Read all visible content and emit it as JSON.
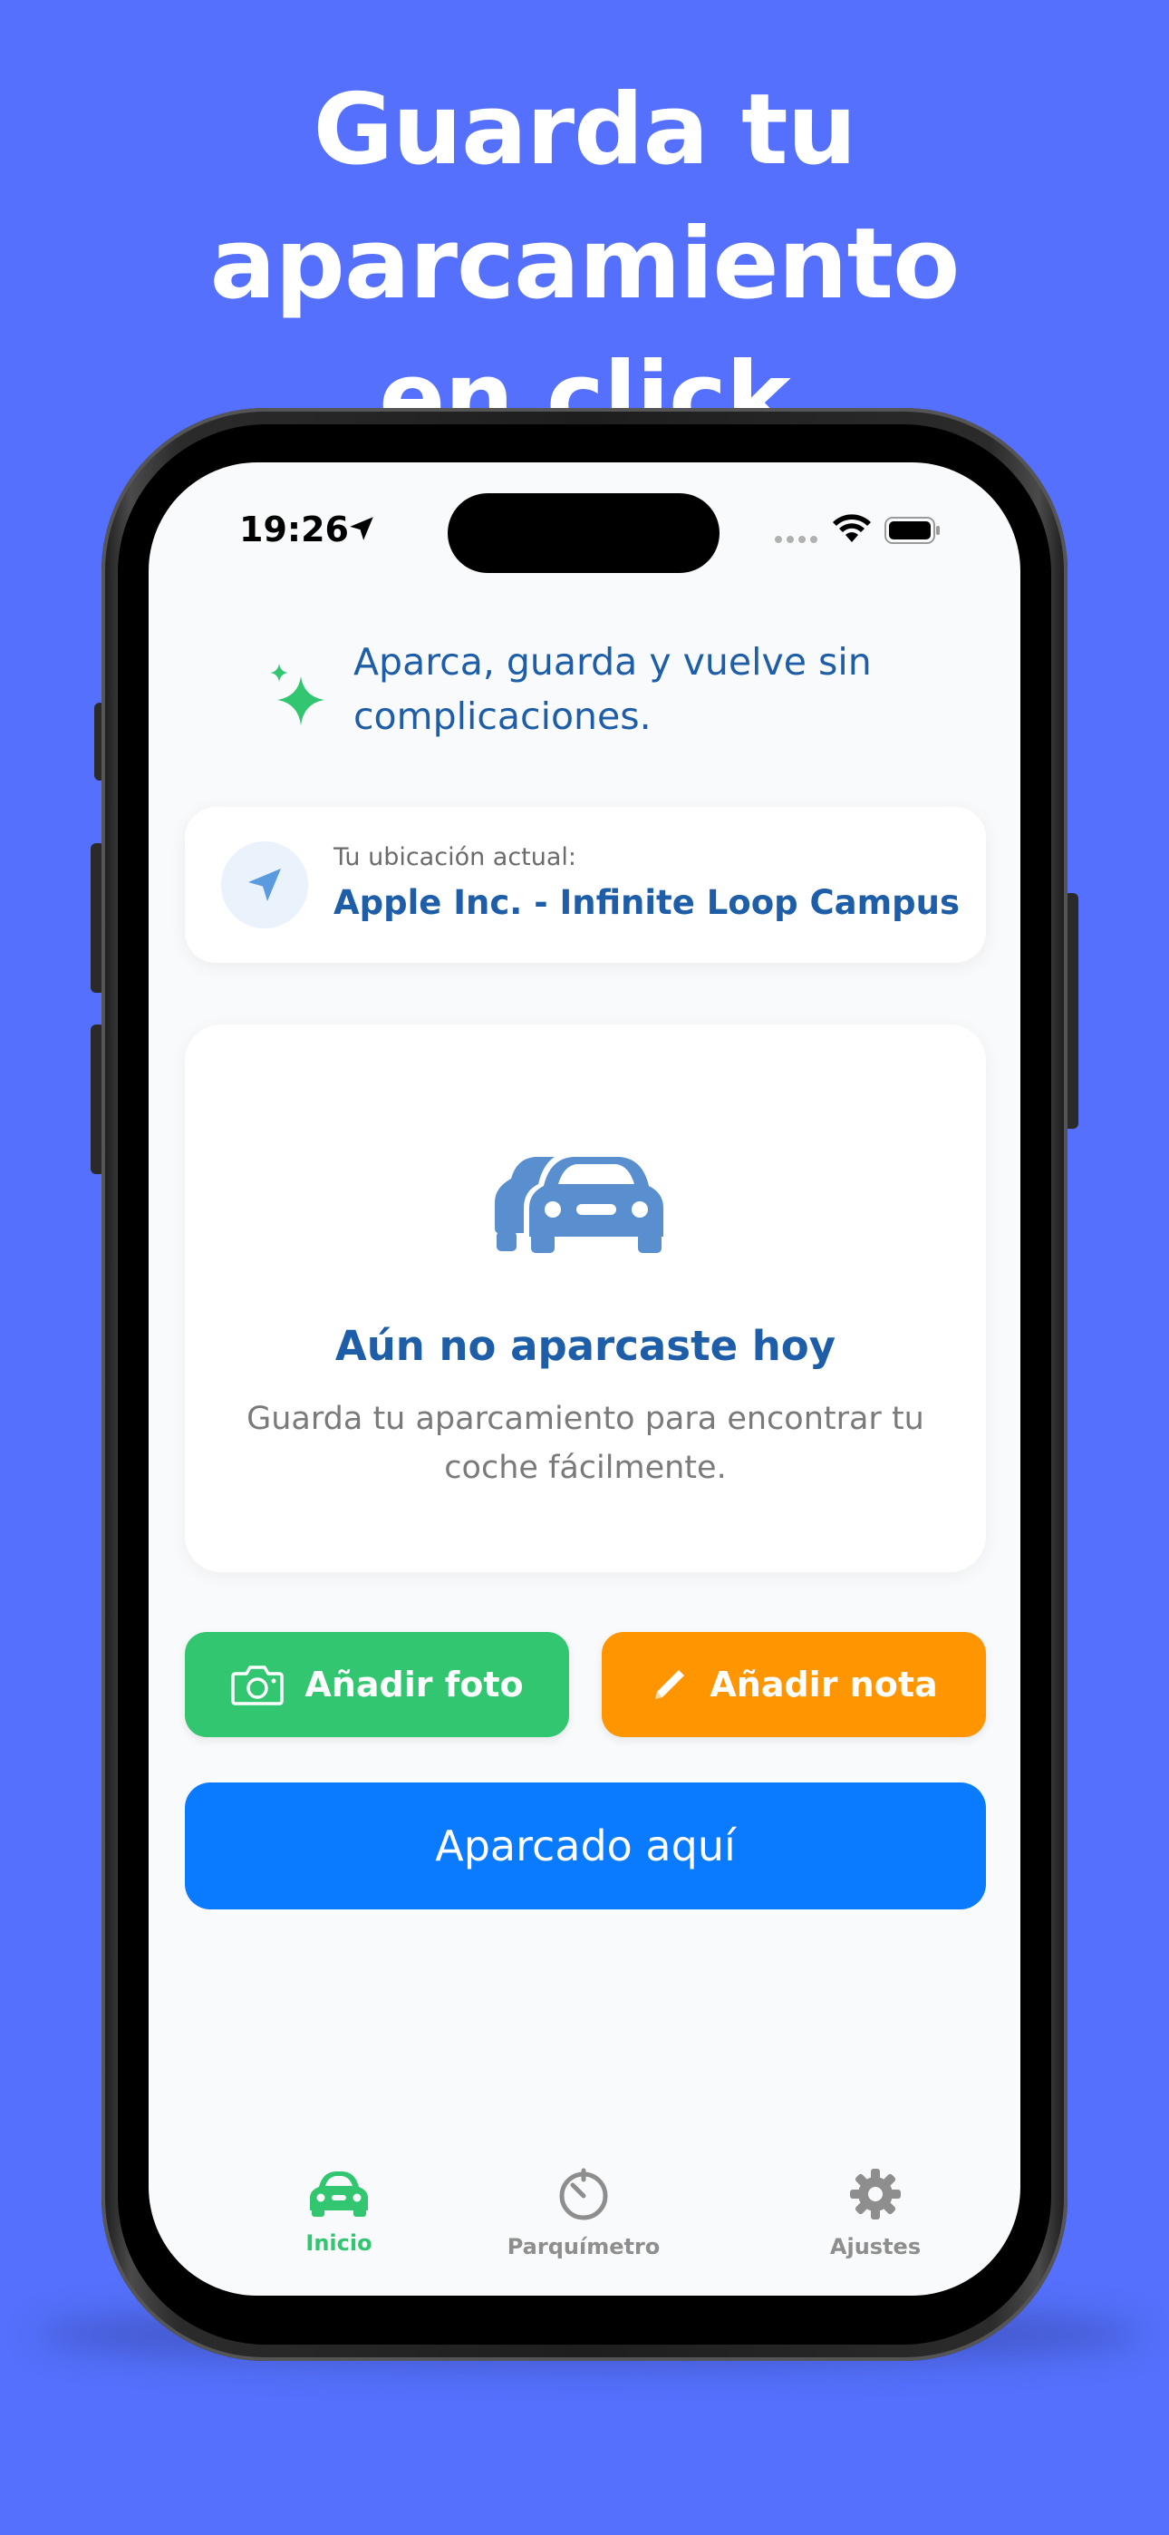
{
  "headline": {
    "line1": "Guarda tu aparcamiento",
    "line2": "en click"
  },
  "status_bar": {
    "time": "19:26"
  },
  "tagline": "Aparca, guarda y vuelve sin complicaciones.",
  "location": {
    "label": "Tu ubicación actual:",
    "value": "Apple Inc. - Infinite Loop Campus"
  },
  "empty_state": {
    "title": "Aún no aparcaste hoy",
    "subtitle": "Guarda tu aparcamiento para encontrar tu coche fácilmente."
  },
  "actions": {
    "add_photo": "Añadir foto",
    "add_note": "Añadir nota",
    "parked_here": "Aparcado aquí"
  },
  "tabs": [
    {
      "label": "Inicio",
      "icon": "car-icon",
      "active": true
    },
    {
      "label": "Parquímetro",
      "icon": "timer-icon",
      "active": false
    },
    {
      "label": "Ajustes",
      "icon": "gear-icon",
      "active": false
    }
  ],
  "colors": {
    "background": "#5470FC",
    "primary_blue": "#0A7AFF",
    "text_blue": "#1E5EA8",
    "green": "#32C671",
    "orange": "#FF9500"
  }
}
